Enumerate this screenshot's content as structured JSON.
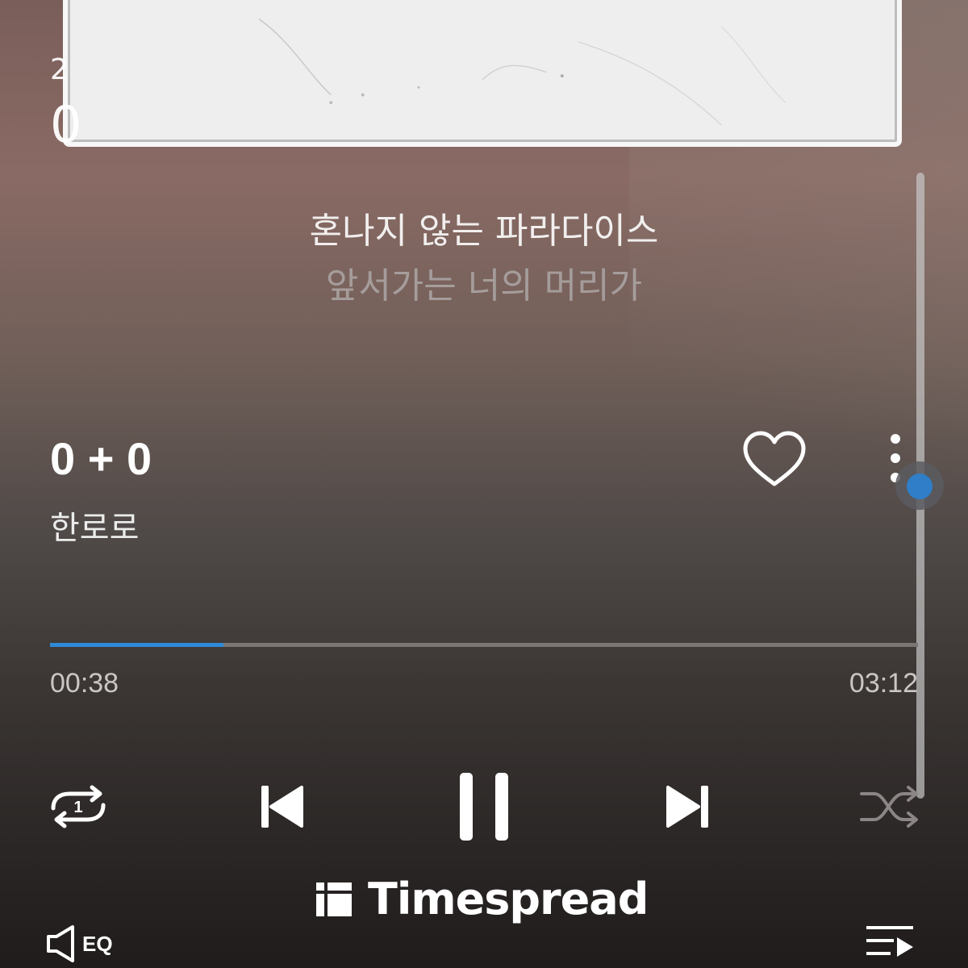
{
  "status": {
    "small": "2",
    "big": "0"
  },
  "lyrics": {
    "current": "혼나지 않는 파라다이스",
    "next": "앞서가는 너의 머리가"
  },
  "track": {
    "title": "0 + 0",
    "artist": "한로로",
    "liked": false
  },
  "playback": {
    "elapsed": "00:38",
    "total": "03:12",
    "progress_fraction": 0.2,
    "is_playing": true,
    "repeat_mode": "repeat-one",
    "repeat_badge": "1"
  },
  "lyrics_scroll": {
    "position_fraction": 0.48
  },
  "brand": {
    "name": "Timespread"
  },
  "bottom_bar": {
    "eq_label": "EQ"
  },
  "colors": {
    "accent": "#2f8ad8",
    "progress_track": "#7b7574",
    "lyric_active": "#f1efee",
    "lyric_inactive": "#a59d9b"
  },
  "icons": {
    "repeat": "repeat-one-icon",
    "previous": "skip-previous-icon",
    "pause": "pause-icon",
    "next": "skip-next-icon",
    "shuffle": "shuffle-icon",
    "like": "heart-icon",
    "more": "more-vertical-icon",
    "eq": "speaker-icon",
    "playlist": "playlist-icon"
  }
}
